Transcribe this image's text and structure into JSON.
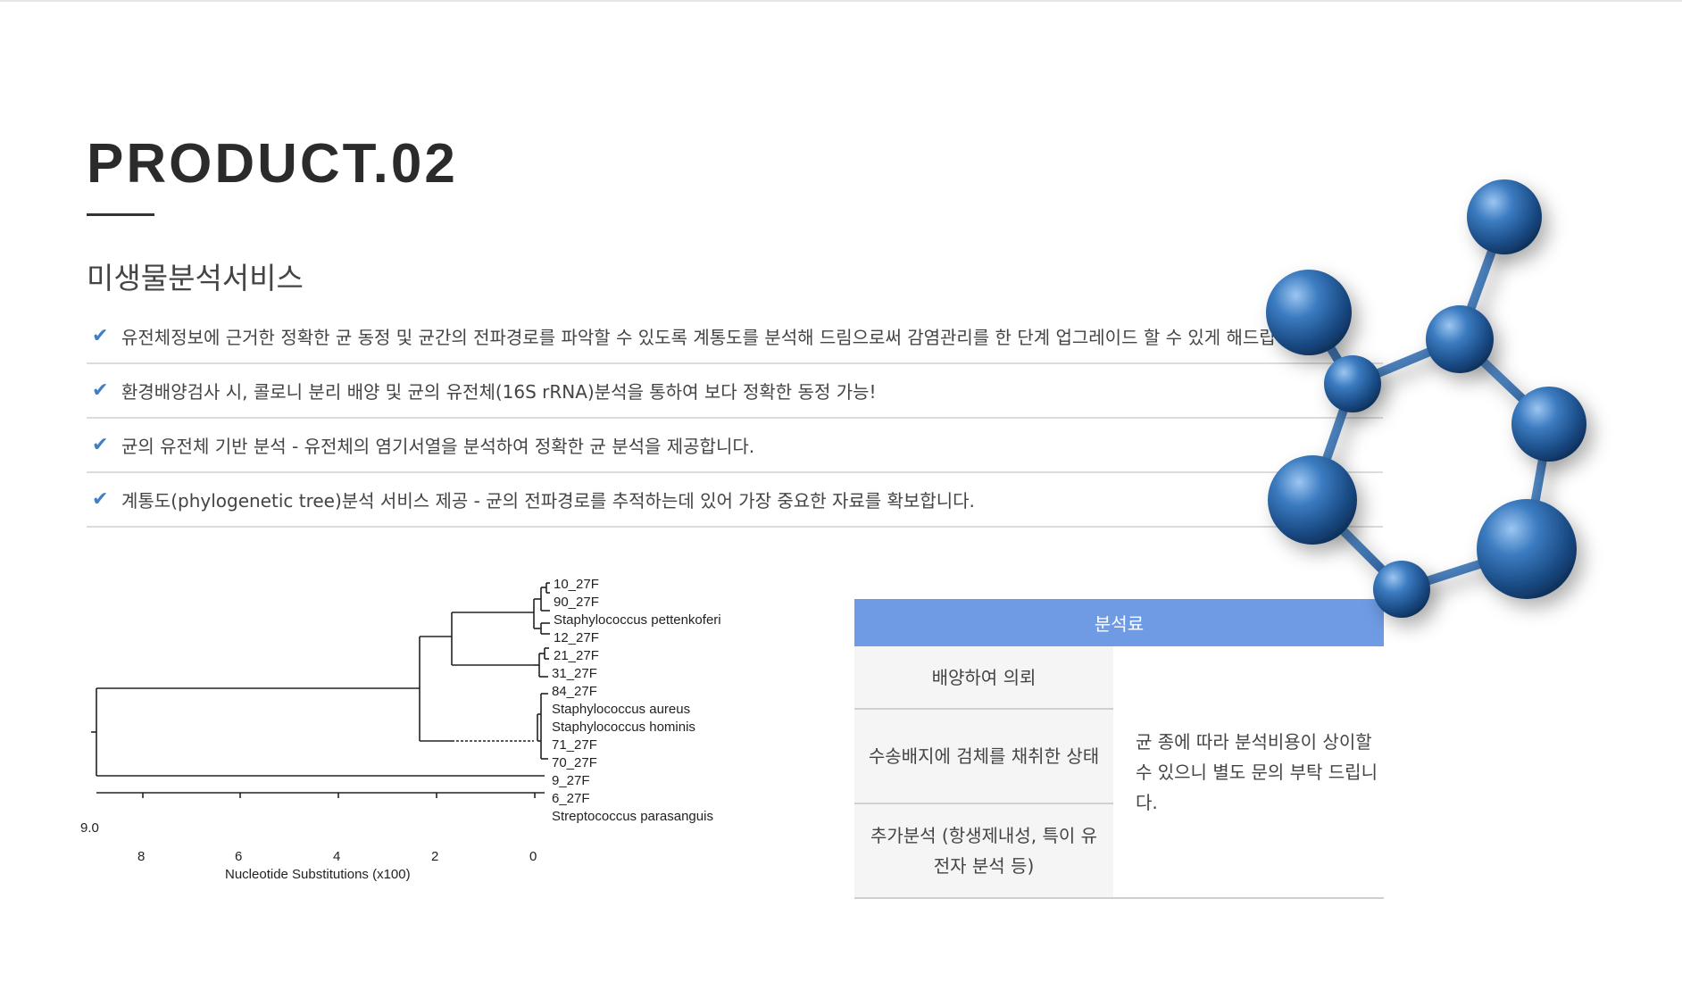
{
  "header": {
    "title": "PRODUCT.02",
    "subtitle": "미생물분석서비스"
  },
  "features": [
    "유전체정보에 근거한 정확한 균 동정 및 균간의 전파경로를 파악할 수 있도록 계통도를 분석해 드림으로써 감염관리를 한 단계 업그레이드 할 수 있게 해드립니다.",
    "환경배양검사 시, 콜로니 분리 배양 및 균의 유전체(16S rRNA)분석을 통하여 보다 정확한 동정 가능!",
    "균의 유전체 기반 분석 - 유전체의 염기서열을 분석하여 정확한 균 분석을 제공합니다.",
    "계통도(phylogenetic tree)분석 서비스 제공 - 균의 전파경로를 추적하는데 있어 가장 중요한 자료를 확보합니다."
  ],
  "tree": {
    "leaves": [
      "10_27F",
      "90_27F",
      "Staphylococcus pettenkoferi",
      "12_27F",
      "21_27F",
      "31_27F",
      "84_27F",
      "Staphylococcus aureus",
      "Staphylococcus hominis",
      "71_27F",
      "70_27F",
      "9_27F",
      "6_27F",
      "Streptococcus parasanguis"
    ],
    "scale_value": "9.0",
    "ticks": [
      "8",
      "6",
      "4",
      "2",
      "0"
    ],
    "axis_label": "Nucleotide Substitutions (x100)"
  },
  "pricing": {
    "header": "분석료",
    "rows": [
      "배양하여 의뢰",
      "수송배지에 검체를 채취한 상태",
      "추가분석 (항생제내성, 특이 유전자 분석 등)"
    ],
    "note": "균 종에 따라 분석비용이 상이할 수 있으니 별도 문의 부탁 드립니다."
  },
  "colors": {
    "accent": "#3f7fc2",
    "table_header": "#6e9be3",
    "molecule": "#2f6aa8"
  },
  "icons": {
    "bullet": "check-icon"
  }
}
